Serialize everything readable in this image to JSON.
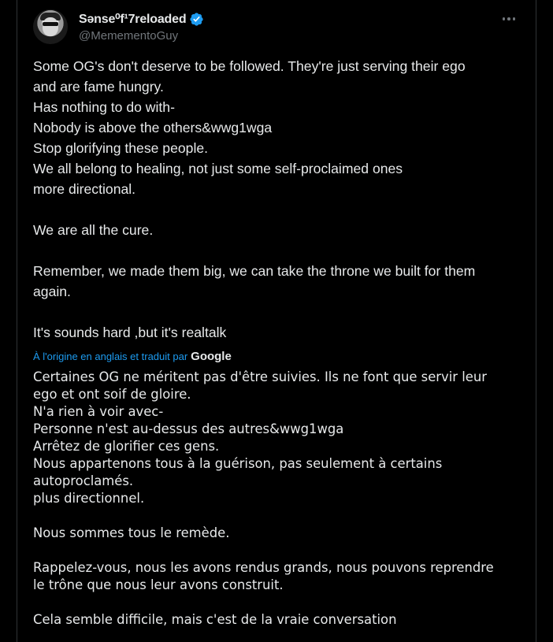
{
  "tweet": {
    "display_name": "Sənse⁰f¹7reloaded",
    "handle": "@MemementoGuy",
    "more_icon": "more-horizontal-icon",
    "verified_icon": "verified-badge-icon",
    "original_lines": [
      "Some OG's don't deserve to be followed. They're just serving their ego",
      "and are fame hungry.",
      "Has nothing to do with-",
      "Nobody is above the others&wwg1wga",
      "Stop glorifying these people.",
      "We all belong to healing, not just some self-proclaimed ones",
      "more directional.",
      "",
      "We are all the cure.",
      "",
      "Remember, we made them big, we can take the throne we built for them",
      "again.",
      "",
      "It's sounds  hard ,but it's realtalk"
    ],
    "translation_label": "À l'origine en anglais et traduit par",
    "translation_provider": "Google",
    "translated_lines": [
      "Certaines OG ne méritent pas d'être suivies. Ils ne font que servir leur",
      "ego et ont soif de gloire.",
      "N'a rien à voir avec-",
      "Personne n'est au-dessus des autres&wwg1wga",
      "Arrêtez de glorifier ces gens.",
      "Nous appartenons tous à la guérison, pas seulement à certains",
      "autoproclamés.",
      "plus directionnel.",
      "",
      "Nous sommes tous le remède.",
      "",
      "Rappelez-vous, nous les avons rendus grands, nous pouvons reprendre",
      "le trône que nous leur avons construit.",
      "",
      "Cela semble difficile, mais c'est de la vraie conversation"
    ]
  },
  "colors": {
    "background": "#000000",
    "text": "#e7e9ea",
    "secondary": "#71767b",
    "accent": "#1d9bf0",
    "border": "#2f3336"
  }
}
